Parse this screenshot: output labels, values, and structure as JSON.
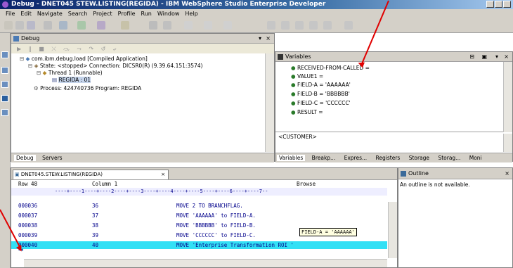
{
  "window": {
    "title": "Debug - DNET045 STEW.LISTING(REGIDA) - IBM WebSphere Studio Enterprise Developer"
  },
  "menu": [
    "File",
    "Edit",
    "Navigate",
    "Search",
    "Project",
    "Profile",
    "Run",
    "Window",
    "Help"
  ],
  "debug_view": {
    "title": "Debug",
    "tree": [
      "com.ibm.debug.load [Compiled Application]",
      "State: <stopped> Connection: DICSR0(R) (9.39.64.151:3574)",
      "Thread 1 (Runnable)",
      "REGIDA : 01",
      "Process: 424740736 Program: REGIDA"
    ],
    "tabs": [
      "Debug",
      "Servers"
    ]
  },
  "variables_view": {
    "title": "Variables",
    "rows": [
      "RECEIVED-FROM-CALLED =",
      "VALUE1 =",
      "FIELD-A = 'AAAAAA'",
      "FIELD-B = 'BBBBBB'",
      "FIELD-C = 'CCCCCC'",
      "RESULT ="
    ],
    "detail_text": "<CUSTOMER>",
    "tabs": [
      "Variables",
      "Breakp...",
      "Expres...",
      "Registers",
      "Storage",
      "Storag...",
      "Moni"
    ]
  },
  "editor": {
    "tab_label": "DNET045.STEW.LISTING(REGIDA)",
    "header": {
      "row": "Row 48",
      "column": "Column 1",
      "mode": "Browse"
    },
    "ruler": "----+----1----+----2----+----3----+----4----+----5----+----6----+----7--",
    "lines": [
      {
        "num": "000036",
        "seq": "36",
        "stmt": "MOVE 2 TO BRANCHFLAG."
      },
      {
        "num": "000037",
        "seq": "37",
        "stmt": "MOVE 'AAAAAA' to FIELD-A."
      },
      {
        "num": "000038",
        "seq": "38",
        "stmt": "MOVE 'BBBBBB' to FIELD-B."
      },
      {
        "num": "000039",
        "seq": "39",
        "stmt": "MOVE 'CCCCCC' to FIELD-C."
      },
      {
        "num": "000040",
        "seq": "40",
        "stmt": "MOVE 'Enterprise Transformation ROI '"
      }
    ],
    "current_line_index": 4,
    "tooltip": "FIELD-A = 'AAAAAA'"
  },
  "outline_view": {
    "title": "Outline",
    "message": "An outline is not available."
  },
  "colors": {
    "highlight_line": "#33e0f5",
    "annotation_arrow": "#e00000",
    "title_bar": "#0a246a"
  }
}
